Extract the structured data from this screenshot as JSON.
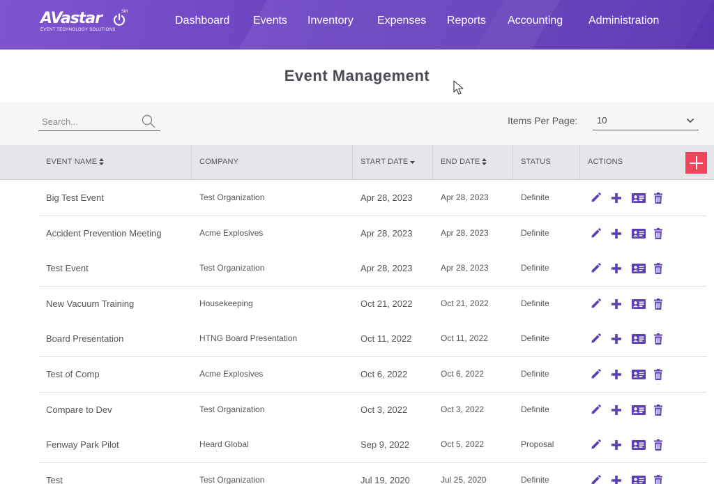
{
  "header": {
    "logo_text": "AVastar",
    "logo_sm": "SM",
    "logo_sub": "EVENT TECHNOLOGY SOLUTIONS",
    "nav": [
      {
        "label": "Dashboard"
      },
      {
        "label": "Events"
      },
      {
        "label": "Inventory"
      },
      {
        "label": "Expenses"
      },
      {
        "label": "Reports"
      },
      {
        "label": "Accounting"
      },
      {
        "label": "Administration"
      }
    ]
  },
  "page": {
    "title": "Event Management"
  },
  "toolbar": {
    "search_placeholder": "Search...",
    "items_per_page_label": "Items Per Page:",
    "items_per_page_value": "10"
  },
  "table": {
    "columns": [
      {
        "label": "EVENT NAME"
      },
      {
        "label": "COMPANY"
      },
      {
        "label": "START DATE"
      },
      {
        "label": "END DATE"
      },
      {
        "label": "STATUS"
      },
      {
        "label": "ACTIONS"
      }
    ],
    "rows": [
      {
        "name": "Big Test Event",
        "company": "Test Organization",
        "start": "Apr 28, 2023",
        "end": "Apr 28, 2023",
        "status": "Definite"
      },
      {
        "name": "Accident Prevention Meeting",
        "company": "Acme Explosives",
        "start": "Apr 28, 2023",
        "end": "Apr 28, 2023",
        "status": "Definite"
      },
      {
        "name": "Test Event",
        "company": "Test Organization",
        "start": "Apr 28, 2023",
        "end": "Apr 28, 2023",
        "status": "Definite"
      },
      {
        "name": "New Vacuum Training",
        "company": "Housekeeping",
        "start": "Oct 21, 2022",
        "end": "Oct 21, 2022",
        "status": "Definite"
      },
      {
        "name": "Board Presentation",
        "company": "HTNG Board Presentation",
        "start": "Oct 11, 2022",
        "end": "Oct 11, 2022",
        "status": "Definite"
      },
      {
        "name": "Test of Comp",
        "company": "Acme Explosives",
        "start": "Oct 6, 2022",
        "end": "Oct 6, 2022",
        "status": "Definite"
      },
      {
        "name": "Compare to Dev",
        "company": "Test Organization",
        "start": "Oct 3, 2022",
        "end": "Oct 3, 2022",
        "status": "Definite"
      },
      {
        "name": "Fenway Park Pilot",
        "company": "Heard Global",
        "start": "Sep 9, 2022",
        "end": "Oct 5, 2022",
        "status": "Proposal"
      },
      {
        "name": "Test",
        "company": "Test Organization",
        "start": "Jul 19, 2020",
        "end": "Jul 25, 2020",
        "status": "Definite"
      }
    ]
  },
  "colors": {
    "header_gradient_start": "#7f55cf",
    "header_gradient_end": "#5b36b3",
    "action_icon": "#5d3fb4",
    "add_button": "#f0455a"
  },
  "icons": {
    "row_actions": [
      "pencil-icon",
      "plus-icon",
      "id-card-icon",
      "trash-icon"
    ]
  }
}
